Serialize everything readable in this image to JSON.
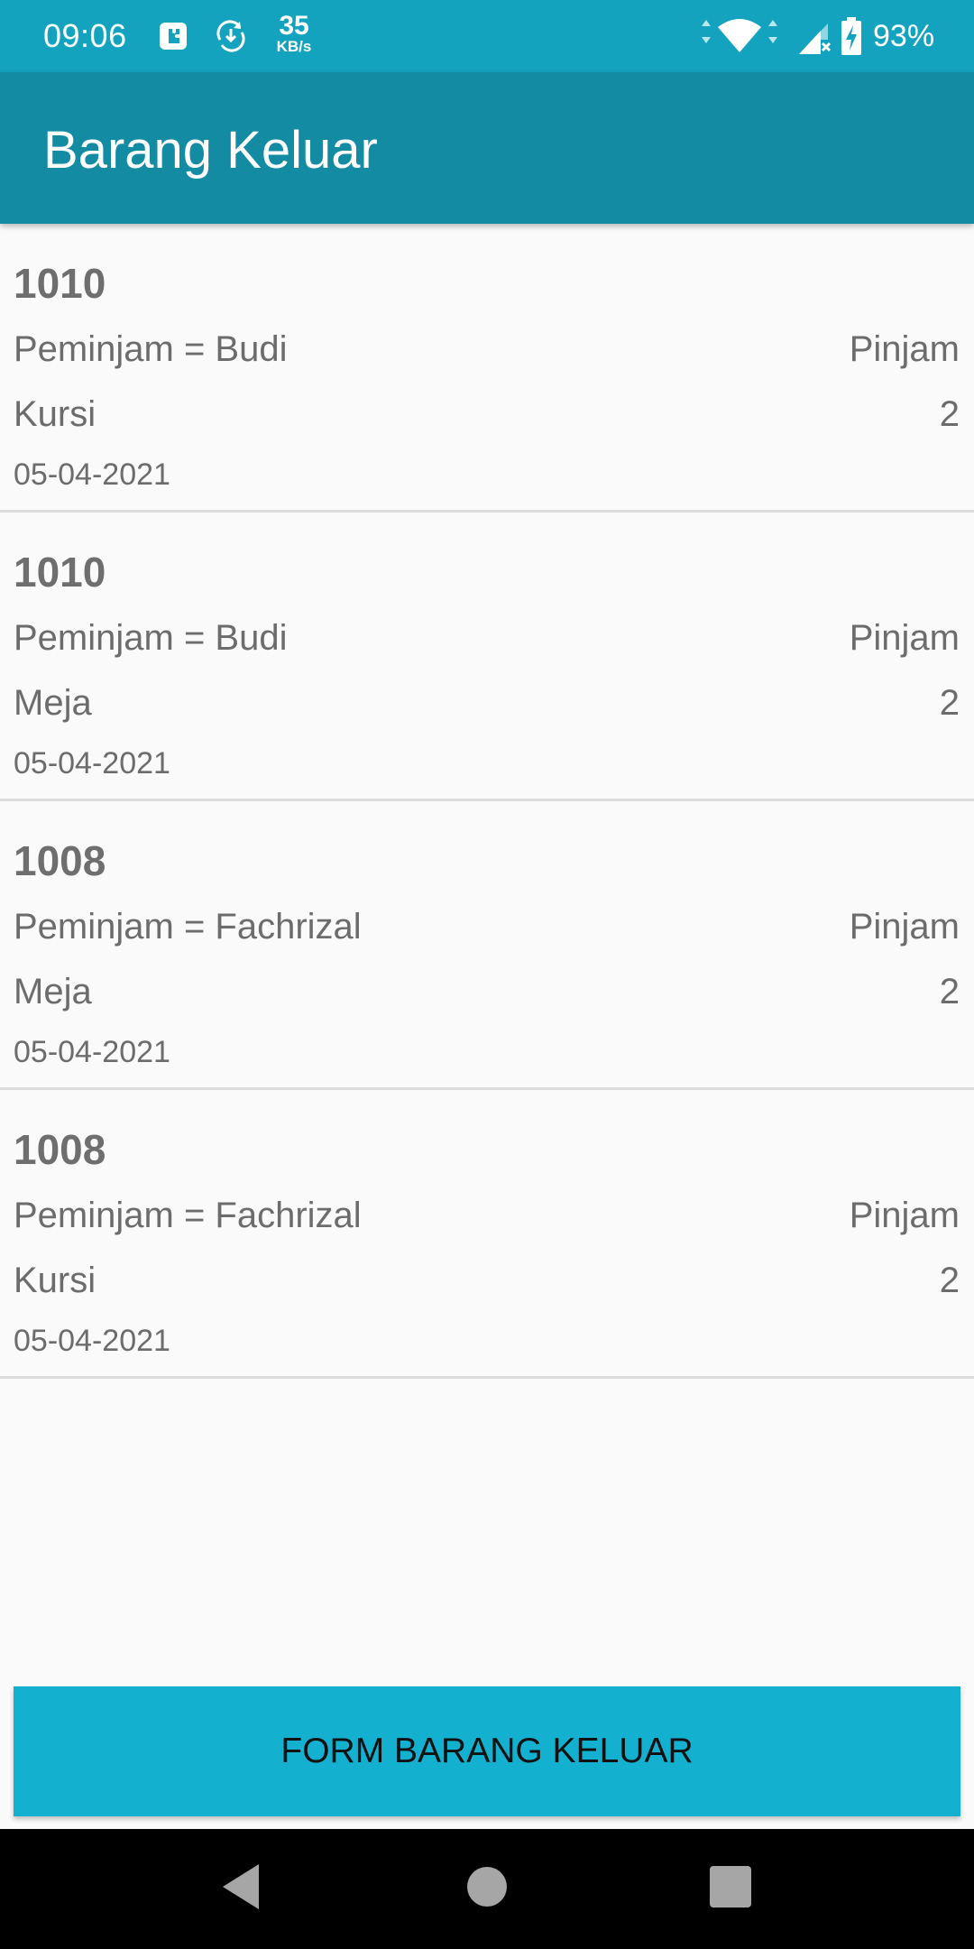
{
  "status_bar": {
    "time": "09:06",
    "speed_value": "35",
    "speed_unit": "KB/s",
    "battery_percent": "93%",
    "icons": [
      "app-notification-icon",
      "sync-download-icon",
      "wifi-icon",
      "signal-icon",
      "battery-charging-icon"
    ]
  },
  "app_bar": {
    "title": "Barang Keluar"
  },
  "items": [
    {
      "code": "1010",
      "borrower": "Peminjam = Budi",
      "status": "Pinjam",
      "goods": "Kursi",
      "qty": "2",
      "date": "05-04-2021"
    },
    {
      "code": "1010",
      "borrower": "Peminjam = Budi",
      "status": "Pinjam",
      "goods": "Meja",
      "qty": "2",
      "date": "05-04-2021"
    },
    {
      "code": "1008",
      "borrower": "Peminjam = Fachrizal",
      "status": "Pinjam",
      "goods": "Meja",
      "qty": "2",
      "date": "05-04-2021"
    },
    {
      "code": "1008",
      "borrower": "Peminjam = Fachrizal",
      "status": "Pinjam",
      "goods": "Kursi",
      "qty": "2",
      "date": "05-04-2021"
    }
  ],
  "form_button": {
    "label": "FORM BARANG KELUAR"
  },
  "nav_bar": {
    "icons": [
      "back-icon",
      "home-icon",
      "recents-icon"
    ]
  },
  "colors": {
    "status_bar": "#13a3bf",
    "app_bar": "#138ba2",
    "button": "#13b0cf",
    "background": "#fafafa"
  }
}
